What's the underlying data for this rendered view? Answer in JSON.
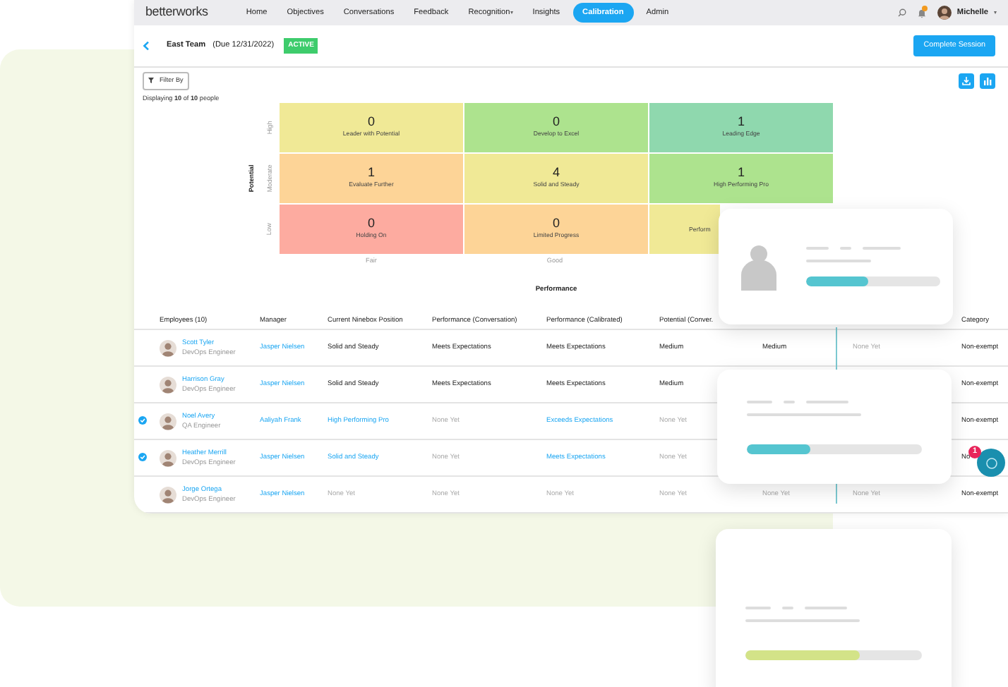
{
  "nav": {
    "logo": "betterworks",
    "items": [
      {
        "label": "Home",
        "selected": false
      },
      {
        "label": "Objectives",
        "selected": false
      },
      {
        "label": "Conversations",
        "selected": false
      },
      {
        "label": "Feedback",
        "selected": false
      },
      {
        "label": "Recognition",
        "selected": false,
        "caret": "▾"
      },
      {
        "label": "Insights",
        "selected": false
      },
      {
        "label": "Calibration",
        "selected": true
      },
      {
        "label": "Admin",
        "selected": false
      }
    ],
    "notification": true,
    "user": "Michelle",
    "user_caret": "▾"
  },
  "header": {
    "title": "East Team",
    "due": "(Due 12/31/2022)",
    "status": "ACTIVE",
    "action": "Complete Session"
  },
  "toolbar": {
    "filter": "Filter By",
    "summary": "Displaying **10** of **10** people"
  },
  "ninebox": {
    "y_axis": "Potential",
    "x_axis": "Performance",
    "row_labels": [
      "High",
      "Moderate",
      "Low"
    ],
    "column_labels": [
      "Fair",
      "Good"
    ],
    "cells": [
      [
        {
          "count": "0",
          "label": "Leader with Potential",
          "color": "#f0e996"
        },
        {
          "count": "0",
          "label": "Develop to Excel",
          "color": "#ade38e"
        },
        {
          "count": "1",
          "label": "Leading Edge",
          "color": "#8fd8ae"
        }
      ],
      [
        {
          "count": "1",
          "label": "Evaluate Further",
          "color": "#fdd497"
        },
        {
          "count": "4",
          "label": "Solid and Steady",
          "color": "#f0e996"
        },
        {
          "count": "1",
          "label": "High Performing Pro",
          "color": "#ade38e"
        }
      ],
      [
        {
          "count": "0",
          "label": "Holding On",
          "color": "#fdaba0"
        },
        {
          "count": "0",
          "label": "Limited Progress",
          "color": "#fdd497"
        },
        {
          "label": "Perform",
          "color": "#f0e996"
        }
      ]
    ]
  },
  "table": {
    "columns": [
      "Employees (10)",
      "Manager",
      "Current Ninebox Position",
      "Performance (Conversation)",
      "Performance (Calibrated)",
      "Potential (Conver.",
      "",
      "",
      "Category"
    ],
    "rows": [
      {
        "checked": false,
        "cells": [
          {
            "name": "Scott Tyler",
            "title": "DevOps Engineer"
          },
          {
            "text": "Jasper Nielsen",
            "kind": "link"
          },
          {
            "text": "Solid and Steady",
            "kind": "plain"
          },
          {
            "text": "Meets Expectations",
            "kind": "plain"
          },
          {
            "text": "Meets Expectations",
            "kind": "plain"
          },
          {
            "text": "Medium",
            "kind": "plain"
          },
          {
            "text": "Medium",
            "kind": "plain"
          },
          {
            "text": "None Yet",
            "kind": "muted"
          },
          {
            "text": "Non-exempt",
            "kind": "plain"
          }
        ]
      },
      {
        "checked": false,
        "cells": [
          {
            "name": "Harrison Gray",
            "title": "DevOps Engineer"
          },
          {
            "text": "Jasper Nielsen",
            "kind": "link"
          },
          {
            "text": "Solid and Steady",
            "kind": "plain"
          },
          {
            "text": "Meets Expectations",
            "kind": "plain"
          },
          {
            "text": "Meets Expectations",
            "kind": "plain"
          },
          {
            "text": "Medium",
            "kind": "plain"
          },
          "",
          "",
          {
            "text": "Non-exempt",
            "kind": "plain"
          }
        ]
      },
      {
        "checked": true,
        "cells": [
          {
            "name": "Noel Avery",
            "title": "QA Engineer"
          },
          {
            "text": "Aaliyah Frank",
            "kind": "link"
          },
          {
            "text": "High Performing Pro",
            "kind": "link"
          },
          {
            "text": "None Yet",
            "kind": "muted"
          },
          {
            "text": "Exceeds Expectations",
            "kind": "link"
          },
          {
            "text": "None Yet",
            "kind": "muted"
          },
          "",
          "",
          {
            "text": "Non-exempt",
            "kind": "plain"
          }
        ]
      },
      {
        "checked": true,
        "cells": [
          {
            "name": "Heather Merrill",
            "title": "DevOps Engineer"
          },
          {
            "text": "Jasper Nielsen",
            "kind": "link"
          },
          {
            "text": "Solid and Steady",
            "kind": "link"
          },
          {
            "text": "None Yet",
            "kind": "muted"
          },
          {
            "text": "Meets Expectations",
            "kind": "link"
          },
          {
            "text": "None Yet",
            "kind": "muted"
          },
          "",
          "",
          {
            "text": "No",
            "kind": "plain"
          }
        ]
      },
      {
        "checked": false,
        "cells": [
          {
            "name": "Jorge Ortega",
            "title": "DevOps Engineer"
          },
          {
            "text": "Jasper Nielsen",
            "kind": "link"
          },
          {
            "text": "None Yet",
            "kind": "muted"
          },
          {
            "text": "None Yet",
            "kind": "muted"
          },
          {
            "text": "None Yet",
            "kind": "muted"
          },
          {
            "text": "None Yet",
            "kind": "muted"
          },
          {
            "text": "None Yet",
            "kind": "muted"
          },
          {
            "text": "None Yet",
            "kind": "muted"
          },
          {
            "text": "Non-exempt",
            "kind": "plain"
          }
        ]
      }
    ]
  },
  "overlay_cards": [
    {
      "kind": "profile",
      "level": 0.46,
      "color": "#55c5d0"
    },
    {
      "kind": "plain",
      "level": 0.36,
      "color": "#55c5d0"
    },
    {
      "kind": "plain",
      "level": 0.65,
      "color": "#d3e388"
    }
  ],
  "chat": {
    "badge": "1"
  }
}
